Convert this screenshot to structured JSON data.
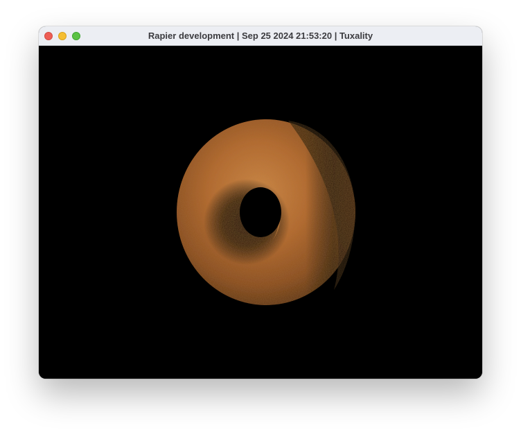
{
  "window": {
    "title": "Rapier development | Sep 25 2024 21:53:20 | Tuxality"
  },
  "traffic_lights": {
    "close_color": "#ee5e56",
    "minimize_color": "#f5be32",
    "zoom_color": "#5cc245"
  },
  "viewport": {
    "background": "#000000",
    "object": "torus",
    "object_color": "#b56a2e"
  }
}
